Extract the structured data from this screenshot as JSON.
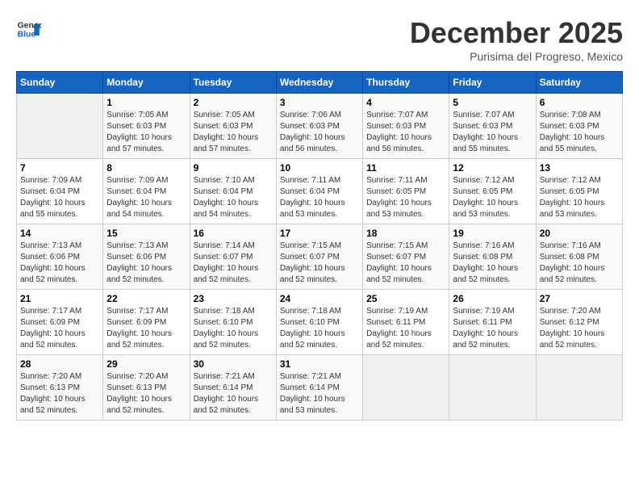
{
  "header": {
    "logo_line1": "General",
    "logo_line2": "Blue",
    "month_title": "December 2025",
    "location": "Purisima del Progreso, Mexico"
  },
  "days_of_week": [
    "Sunday",
    "Monday",
    "Tuesday",
    "Wednesday",
    "Thursday",
    "Friday",
    "Saturday"
  ],
  "weeks": [
    [
      {
        "day": "",
        "sunrise": "",
        "sunset": "",
        "daylight": ""
      },
      {
        "day": "1",
        "sunrise": "Sunrise: 7:05 AM",
        "sunset": "Sunset: 6:03 PM",
        "daylight": "Daylight: 10 hours and 57 minutes."
      },
      {
        "day": "2",
        "sunrise": "Sunrise: 7:05 AM",
        "sunset": "Sunset: 6:03 PM",
        "daylight": "Daylight: 10 hours and 57 minutes."
      },
      {
        "day": "3",
        "sunrise": "Sunrise: 7:06 AM",
        "sunset": "Sunset: 6:03 PM",
        "daylight": "Daylight: 10 hours and 56 minutes."
      },
      {
        "day": "4",
        "sunrise": "Sunrise: 7:07 AM",
        "sunset": "Sunset: 6:03 PM",
        "daylight": "Daylight: 10 hours and 56 minutes."
      },
      {
        "day": "5",
        "sunrise": "Sunrise: 7:07 AM",
        "sunset": "Sunset: 6:03 PM",
        "daylight": "Daylight: 10 hours and 55 minutes."
      },
      {
        "day": "6",
        "sunrise": "Sunrise: 7:08 AM",
        "sunset": "Sunset: 6:03 PM",
        "daylight": "Daylight: 10 hours and 55 minutes."
      }
    ],
    [
      {
        "day": "7",
        "sunrise": "Sunrise: 7:09 AM",
        "sunset": "Sunset: 6:04 PM",
        "daylight": "Daylight: 10 hours and 55 minutes."
      },
      {
        "day": "8",
        "sunrise": "Sunrise: 7:09 AM",
        "sunset": "Sunset: 6:04 PM",
        "daylight": "Daylight: 10 hours and 54 minutes."
      },
      {
        "day": "9",
        "sunrise": "Sunrise: 7:10 AM",
        "sunset": "Sunset: 6:04 PM",
        "daylight": "Daylight: 10 hours and 54 minutes."
      },
      {
        "day": "10",
        "sunrise": "Sunrise: 7:11 AM",
        "sunset": "Sunset: 6:04 PM",
        "daylight": "Daylight: 10 hours and 53 minutes."
      },
      {
        "day": "11",
        "sunrise": "Sunrise: 7:11 AM",
        "sunset": "Sunset: 6:05 PM",
        "daylight": "Daylight: 10 hours and 53 minutes."
      },
      {
        "day": "12",
        "sunrise": "Sunrise: 7:12 AM",
        "sunset": "Sunset: 6:05 PM",
        "daylight": "Daylight: 10 hours and 53 minutes."
      },
      {
        "day": "13",
        "sunrise": "Sunrise: 7:12 AM",
        "sunset": "Sunset: 6:05 PM",
        "daylight": "Daylight: 10 hours and 53 minutes."
      }
    ],
    [
      {
        "day": "14",
        "sunrise": "Sunrise: 7:13 AM",
        "sunset": "Sunset: 6:06 PM",
        "daylight": "Daylight: 10 hours and 52 minutes."
      },
      {
        "day": "15",
        "sunrise": "Sunrise: 7:13 AM",
        "sunset": "Sunset: 6:06 PM",
        "daylight": "Daylight: 10 hours and 52 minutes."
      },
      {
        "day": "16",
        "sunrise": "Sunrise: 7:14 AM",
        "sunset": "Sunset: 6:07 PM",
        "daylight": "Daylight: 10 hours and 52 minutes."
      },
      {
        "day": "17",
        "sunrise": "Sunrise: 7:15 AM",
        "sunset": "Sunset: 6:07 PM",
        "daylight": "Daylight: 10 hours and 52 minutes."
      },
      {
        "day": "18",
        "sunrise": "Sunrise: 7:15 AM",
        "sunset": "Sunset: 6:07 PM",
        "daylight": "Daylight: 10 hours and 52 minutes."
      },
      {
        "day": "19",
        "sunrise": "Sunrise: 7:16 AM",
        "sunset": "Sunset: 6:08 PM",
        "daylight": "Daylight: 10 hours and 52 minutes."
      },
      {
        "day": "20",
        "sunrise": "Sunrise: 7:16 AM",
        "sunset": "Sunset: 6:08 PM",
        "daylight": "Daylight: 10 hours and 52 minutes."
      }
    ],
    [
      {
        "day": "21",
        "sunrise": "Sunrise: 7:17 AM",
        "sunset": "Sunset: 6:09 PM",
        "daylight": "Daylight: 10 hours and 52 minutes."
      },
      {
        "day": "22",
        "sunrise": "Sunrise: 7:17 AM",
        "sunset": "Sunset: 6:09 PM",
        "daylight": "Daylight: 10 hours and 52 minutes."
      },
      {
        "day": "23",
        "sunrise": "Sunrise: 7:18 AM",
        "sunset": "Sunset: 6:10 PM",
        "daylight": "Daylight: 10 hours and 52 minutes."
      },
      {
        "day": "24",
        "sunrise": "Sunrise: 7:18 AM",
        "sunset": "Sunset: 6:10 PM",
        "daylight": "Daylight: 10 hours and 52 minutes."
      },
      {
        "day": "25",
        "sunrise": "Sunrise: 7:19 AM",
        "sunset": "Sunset: 6:11 PM",
        "daylight": "Daylight: 10 hours and 52 minutes."
      },
      {
        "day": "26",
        "sunrise": "Sunrise: 7:19 AM",
        "sunset": "Sunset: 6:11 PM",
        "daylight": "Daylight: 10 hours and 52 minutes."
      },
      {
        "day": "27",
        "sunrise": "Sunrise: 7:20 AM",
        "sunset": "Sunset: 6:12 PM",
        "daylight": "Daylight: 10 hours and 52 minutes."
      }
    ],
    [
      {
        "day": "28",
        "sunrise": "Sunrise: 7:20 AM",
        "sunset": "Sunset: 6:13 PM",
        "daylight": "Daylight: 10 hours and 52 minutes."
      },
      {
        "day": "29",
        "sunrise": "Sunrise: 7:20 AM",
        "sunset": "Sunset: 6:13 PM",
        "daylight": "Daylight: 10 hours and 52 minutes."
      },
      {
        "day": "30",
        "sunrise": "Sunrise: 7:21 AM",
        "sunset": "Sunset: 6:14 PM",
        "daylight": "Daylight: 10 hours and 52 minutes."
      },
      {
        "day": "31",
        "sunrise": "Sunrise: 7:21 AM",
        "sunset": "Sunset: 6:14 PM",
        "daylight": "Daylight: 10 hours and 53 minutes."
      },
      {
        "day": "",
        "sunrise": "",
        "sunset": "",
        "daylight": ""
      },
      {
        "day": "",
        "sunrise": "",
        "sunset": "",
        "daylight": ""
      },
      {
        "day": "",
        "sunrise": "",
        "sunset": "",
        "daylight": ""
      }
    ]
  ]
}
